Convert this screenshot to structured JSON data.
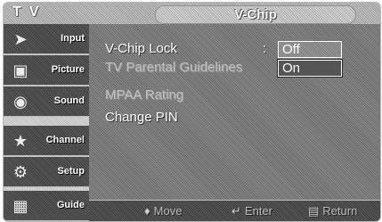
{
  "header": {
    "source_label": "TV",
    "title": "V-Chip"
  },
  "sidebar": {
    "items": [
      {
        "label": "Input",
        "icon": "input-icon"
      },
      {
        "label": "Picture",
        "icon": "picture-icon"
      },
      {
        "label": "Sound",
        "icon": "sound-icon"
      },
      {
        "label": "Channel",
        "icon": "channel-icon"
      },
      {
        "label": "Setup",
        "icon": "setup-icon"
      },
      {
        "label": "Guide",
        "icon": "guide-icon"
      }
    ]
  },
  "menu": {
    "items": [
      {
        "label": "V-Chip Lock",
        "enabled": true
      },
      {
        "label": "TV Parental Guidelines",
        "enabled": false
      },
      {
        "label": "MPAA Rating",
        "enabled": false
      },
      {
        "label": "Change PIN",
        "enabled": true
      }
    ],
    "separator": ":",
    "options": [
      {
        "label": "Off",
        "selected": false
      },
      {
        "label": "On",
        "selected": true
      }
    ]
  },
  "footer": {
    "hints": [
      {
        "icon": "move-icon",
        "label": "Move"
      },
      {
        "icon": "enter-icon",
        "label": "Enter"
      },
      {
        "icon": "return-icon",
        "label": "Return"
      }
    ]
  }
}
